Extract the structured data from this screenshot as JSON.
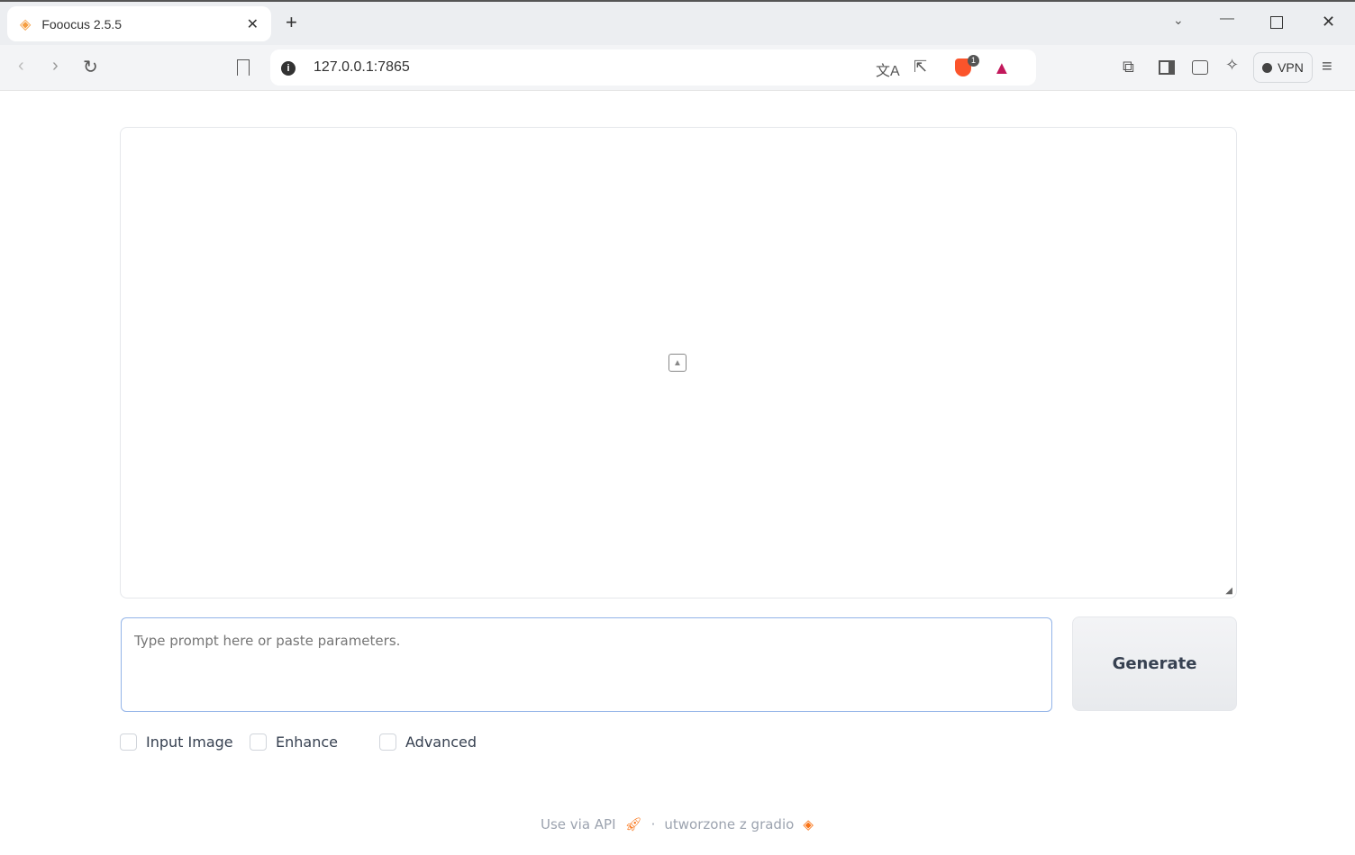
{
  "browser": {
    "tab_title": "Fooocus 2.5.5",
    "url": "127.0.0.1:7865",
    "vpn_label": "VPN",
    "shield_badge": "1"
  },
  "main": {
    "prompt_placeholder": "Type prompt here or paste parameters.",
    "generate_label": "Generate",
    "checkboxes": [
      {
        "label": "Input Image",
        "checked": false
      },
      {
        "label": "Enhance",
        "checked": false
      },
      {
        "label": "Advanced",
        "checked": false
      }
    ]
  },
  "footer": {
    "api_link": "Use via API",
    "separator": "·",
    "built_with": "utworzone z gradio"
  },
  "colors": {
    "accent": "#f97316",
    "brave": "#fb542b"
  }
}
